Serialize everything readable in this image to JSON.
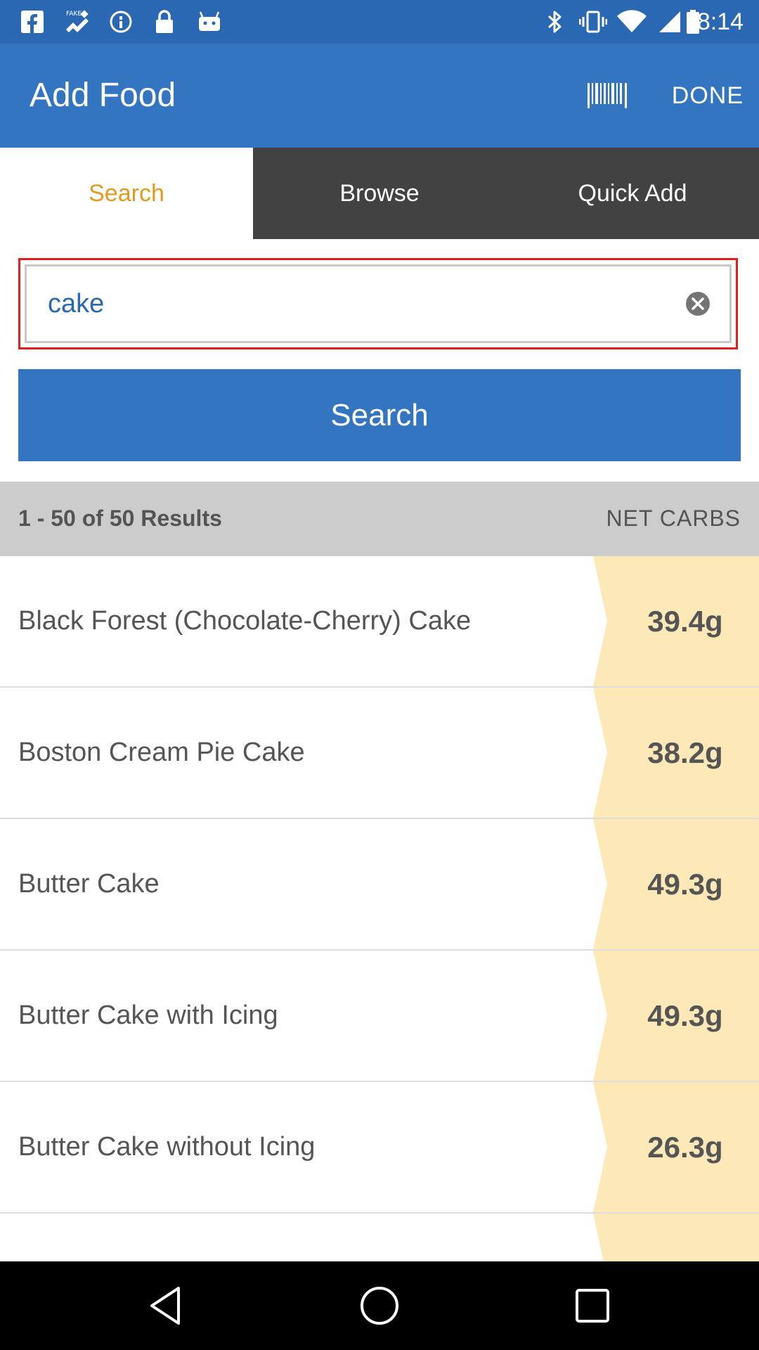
{
  "status_bar": {
    "time": "8:14",
    "left_icons": [
      "facebook-icon",
      "fake-gps-icon",
      "info-icon",
      "lock-icon",
      "android-icon"
    ],
    "right_icons": [
      "bluetooth-icon",
      "vibrate-icon",
      "wifi-icon",
      "signal-icon",
      "battery-icon"
    ]
  },
  "app_bar": {
    "title": "Add Food",
    "barcode_icon": "barcode-icon",
    "done_label": "DONE"
  },
  "tabs": [
    {
      "label": "Search",
      "active": true
    },
    {
      "label": "Browse",
      "active": false
    },
    {
      "label": "Quick Add",
      "active": false
    }
  ],
  "search": {
    "value": "cake",
    "button_label": "Search"
  },
  "results": {
    "count_label": "1 - 50 of 50 Results",
    "column_label": "NET CARBS",
    "items": [
      {
        "name": "Black Forest (Chocolate-Cherry) Cake",
        "carbs": "39.4g"
      },
      {
        "name": "Boston Cream Pie Cake",
        "carbs": "38.2g"
      },
      {
        "name": "Butter Cake",
        "carbs": "49.3g"
      },
      {
        "name": "Butter Cake with Icing",
        "carbs": "49.3g"
      },
      {
        "name": "Butter Cake without Icing",
        "carbs": "26.3g"
      },
      {
        "name": "",
        "carbs": ""
      }
    ]
  },
  "nav_bar": {
    "icons": [
      "back-icon",
      "home-icon",
      "recents-icon"
    ]
  },
  "colors": {
    "primary": "#3375c1",
    "status_bar": "#2a68b4",
    "tab_active_text": "#e39a1e",
    "tab_inactive_bg": "#424242",
    "highlight_border": "#e02020",
    "carb_cell_bg": "#fde9b8"
  }
}
